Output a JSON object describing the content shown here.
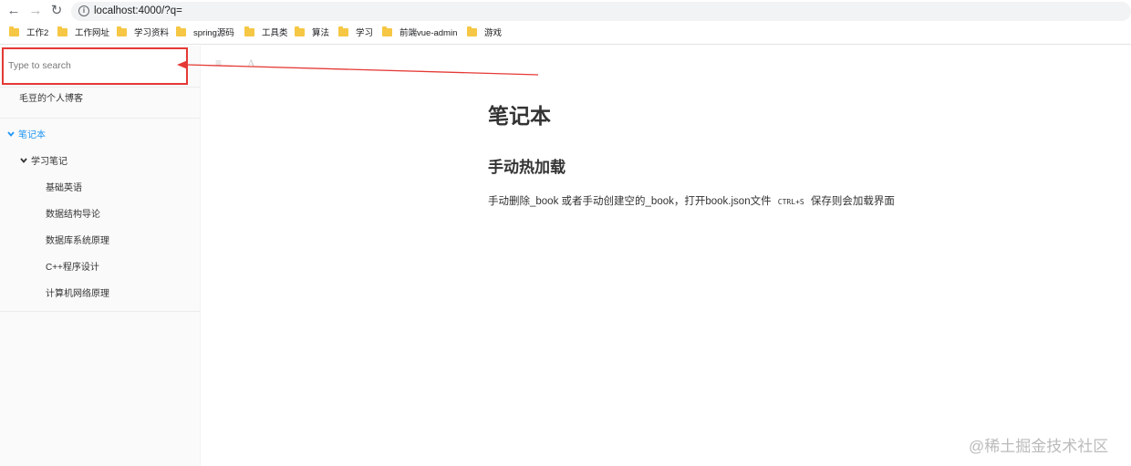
{
  "browser": {
    "url": "localhost:4000/?q=",
    "bookmarks": [
      "工作2",
      "工作网址",
      "学习资料",
      "spring源码",
      "工具类",
      "算法",
      "学习",
      "前端vue-admin",
      "游戏"
    ]
  },
  "sidebar": {
    "search_placeholder": "Type to search",
    "blog_link": "毛豆的个人博客",
    "section": "笔记本",
    "subsection": "学习笔记",
    "notes": [
      "基础英语",
      "数据结构导论",
      "数据库系统原理",
      "C++程序设计",
      "计算机网络原理"
    ]
  },
  "content": {
    "toolbar_icons": [
      "list-icon",
      "font-icon"
    ],
    "title": "笔记本",
    "heading": "手动热加载",
    "paragraph_before": "手动删除_book 或者手动创建空的_book，打开book.json文件",
    "shortcut": "CTRL+S",
    "paragraph_after": "保存则会加载界面"
  },
  "watermark": "@稀土掘金技术社区",
  "colors": {
    "accent": "#2196f3",
    "highlight": "#e53935",
    "folder": "#f6c744"
  }
}
